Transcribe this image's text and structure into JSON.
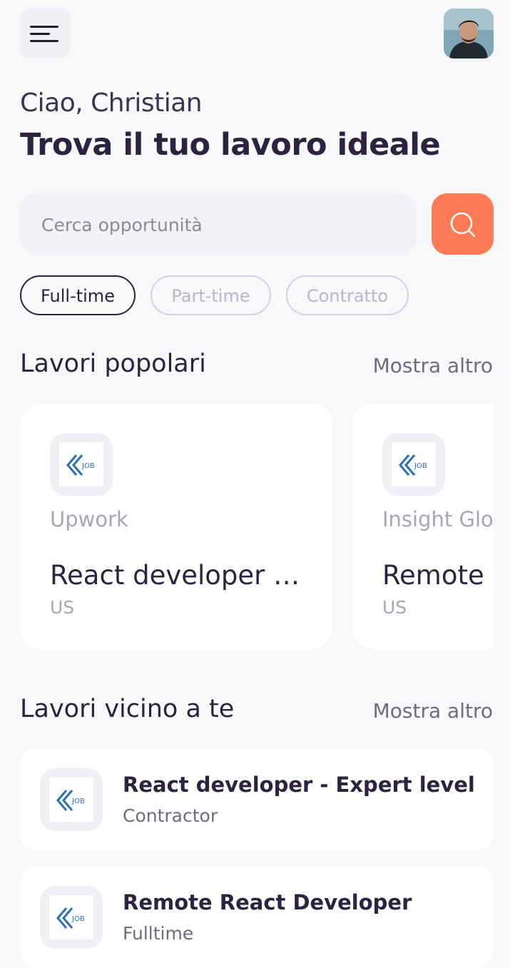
{
  "header": {
    "menu_icon": "hamburger-menu-icon",
    "avatar": "profile-avatar"
  },
  "greeting": "Ciao, Christian",
  "headline": "Trova il tuo lavoro ideale",
  "search": {
    "placeholder": "Cerca opportunità",
    "button_icon": "search-icon"
  },
  "filters": [
    {
      "label": "Full-time",
      "active": true
    },
    {
      "label": "Part-time",
      "active": false
    },
    {
      "label": "Contratto",
      "active": false
    }
  ],
  "popular": {
    "title": "Lavori popolari",
    "more": "Mostra altro",
    "jobs": [
      {
        "company": "Upwork",
        "title": "React developer -…",
        "location": "US",
        "logo_text": "JOB"
      },
      {
        "company": "Insight Glob",
        "title": "Remote I",
        "location": "US",
        "logo_text": "JOB"
      }
    ]
  },
  "nearby": {
    "title": "Lavori vicino a te",
    "more": "Mostra altro",
    "jobs": [
      {
        "title": "React developer - Expert level",
        "type": "Contractor",
        "logo_text": "JOB"
      },
      {
        "title": "Remote React Developer",
        "type": "Fulltime",
        "logo_text": "JOB"
      }
    ]
  },
  "colors": {
    "accent": "#ff7a55",
    "text_dark": "#2b2340",
    "background": "#f8f8fb"
  }
}
